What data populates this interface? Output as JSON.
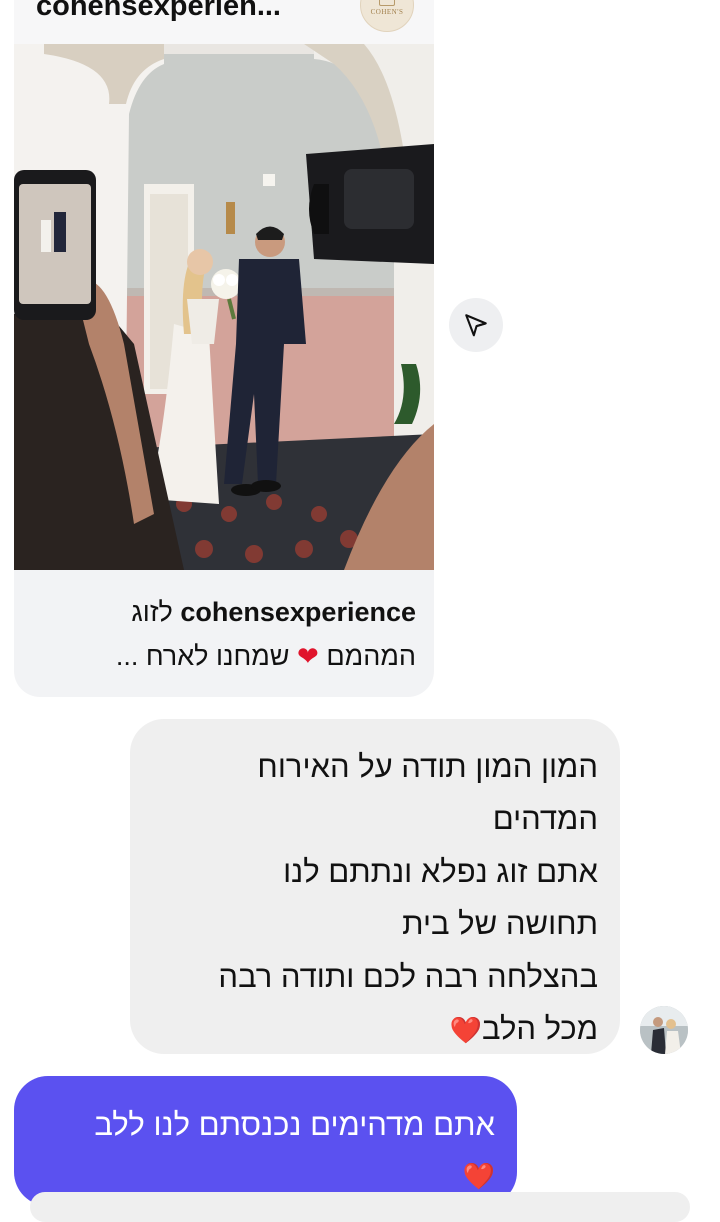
{
  "shared_post": {
    "username": "cohensexperien...",
    "avatar_logo_text": "COHEN'S",
    "photo_icon": "wedding-photo",
    "caption_handle": "cohensexperience",
    "caption_part1": "לזוג",
    "caption_part2": "המהמם",
    "caption_part3": "שמחנו לארח ..."
  },
  "share_icon": "paper-plane-icon",
  "incoming_message": {
    "lines": [
      "המון המון תודה על האירוח",
      "המדהים",
      "אתם זוג נפלא ונתתם לנו",
      "תחושה של בית",
      "בהצלחה רבה לכם ותודה רבה",
      "מכל הלב"
    ]
  },
  "outgoing_message": {
    "line1": "אתם מדהימים נכנסתם לנו ללב"
  },
  "colors": {
    "outgoing_bubble": "#5b51f0",
    "incoming_bubble": "#efefef",
    "heart": "#e0142c"
  }
}
